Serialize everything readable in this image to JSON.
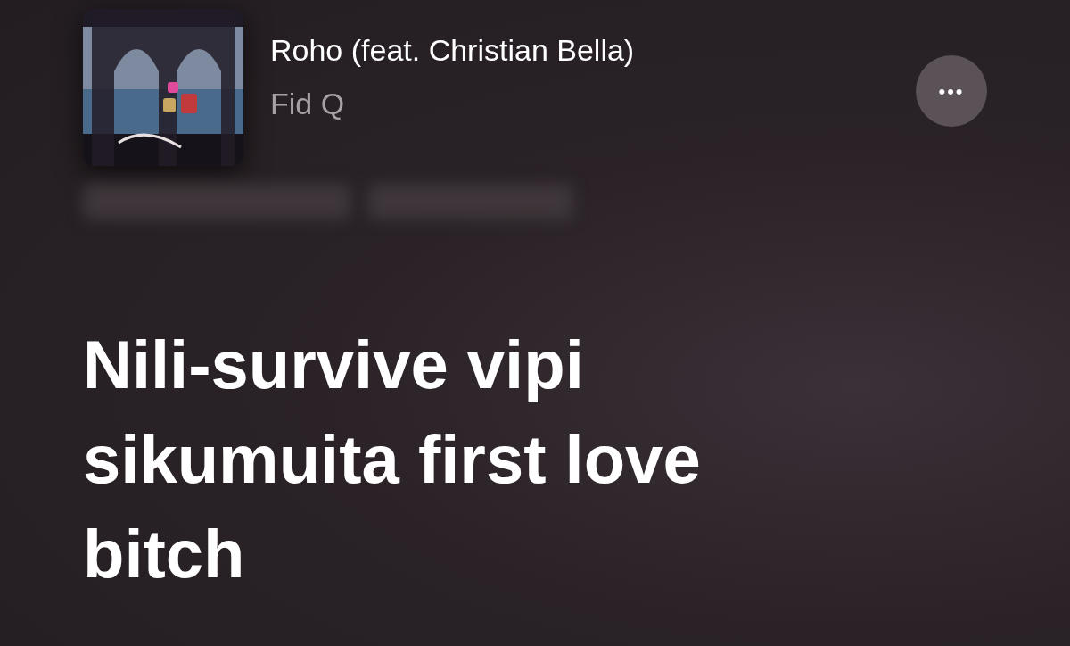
{
  "now_playing": {
    "title": "Roho (feat. Christian Bella)",
    "artist": "Fid Q",
    "more_button": "•••"
  },
  "lyrics": {
    "current_lines": [
      "Nili-survive vipi",
      "sikumuita first love",
      "bitch"
    ]
  }
}
